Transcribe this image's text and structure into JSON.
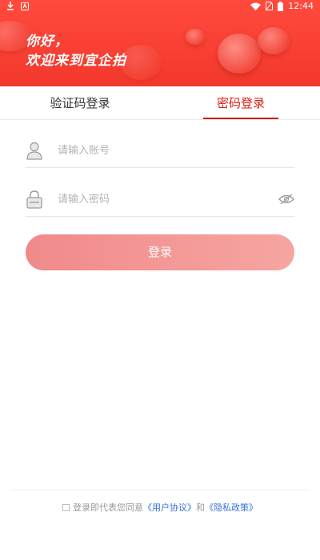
{
  "statusbar": {
    "time": "12:44",
    "icons": [
      "download-icon",
      "app-notification-icon",
      "wifi-icon",
      "sim-off-icon",
      "battery-icon"
    ]
  },
  "header": {
    "greeting_line1": "你好，",
    "greeting_line2": "欢迎来到宜企拍"
  },
  "tabs": [
    {
      "label": "验证码登录",
      "active": false
    },
    {
      "label": "密码登录",
      "active": true
    }
  ],
  "form": {
    "account_placeholder": "请输入账号",
    "password_placeholder": "请输入密码",
    "login_label": "登录"
  },
  "agreement": {
    "prefix": "登录即代表您同意",
    "user_agreement": "《用户协议》",
    "conjunction": "和",
    "privacy_policy": "《隐私政策》"
  },
  "colors": {
    "brand_red": "#f2382c",
    "active_tab": "#d81e12",
    "button_gradient_start": "#f08a8a",
    "button_gradient_end": "#f6a5a1",
    "link": "#3a6fd8"
  }
}
